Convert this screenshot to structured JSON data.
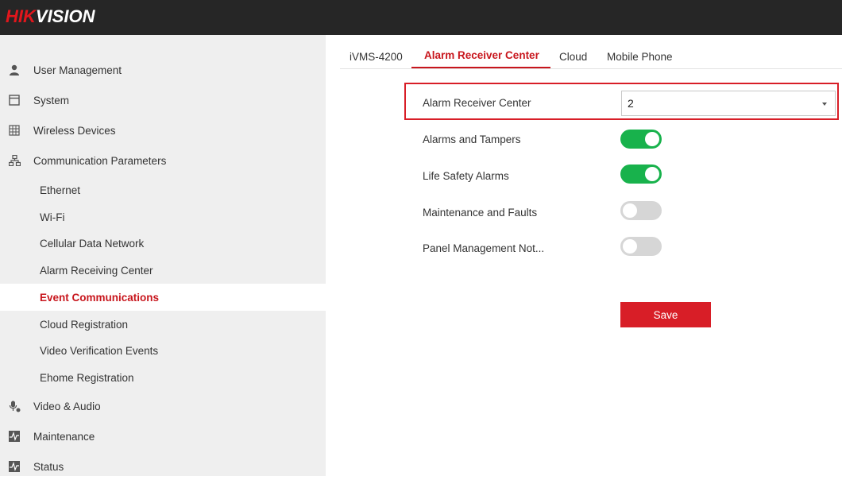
{
  "brand": {
    "logo_prefix": "HIK",
    "logo_suffix": "VISION"
  },
  "sidebar": {
    "items": [
      {
        "label": "User Management",
        "icon": "user-icon"
      },
      {
        "label": "System",
        "icon": "system-icon"
      },
      {
        "label": "Wireless Devices",
        "icon": "wireless-devices-icon"
      },
      {
        "label": "Communication Parameters",
        "icon": "network-icon"
      },
      {
        "label": "Ethernet"
      },
      {
        "label": "Wi-Fi"
      },
      {
        "label": "Cellular Data Network"
      },
      {
        "label": "Alarm Receiving Center"
      },
      {
        "label": "Event Communications",
        "active": true
      },
      {
        "label": "Cloud Registration"
      },
      {
        "label": "Video Verification Events"
      },
      {
        "label": "Ehome Registration"
      },
      {
        "label": "Video & Audio",
        "icon": "microphone-icon"
      },
      {
        "label": "Maintenance",
        "icon": "maintenance-icon"
      },
      {
        "label": "Status",
        "icon": "status-icon"
      }
    ]
  },
  "tabs": [
    {
      "label": "iVMS-4200"
    },
    {
      "label": "Alarm Receiver Center",
      "active": true
    },
    {
      "label": "Cloud"
    },
    {
      "label": "Mobile Phone"
    }
  ],
  "form": {
    "receiver": {
      "label": "Alarm Receiver Center",
      "value": "2"
    },
    "toggles": [
      {
        "label": "Alarms and Tampers",
        "on": true
      },
      {
        "label": "Life Safety Alarms",
        "on": true
      },
      {
        "label": "Maintenance and Faults",
        "on": false
      },
      {
        "label": "Panel Management Not...",
        "on": false
      }
    ],
    "save_label": "Save"
  },
  "colors": {
    "accent": "#c8161d",
    "toggle_on": "#18b24c",
    "toggle_off": "#d6d6d6",
    "topbar": "#262626",
    "sidebar": "#efefef"
  }
}
